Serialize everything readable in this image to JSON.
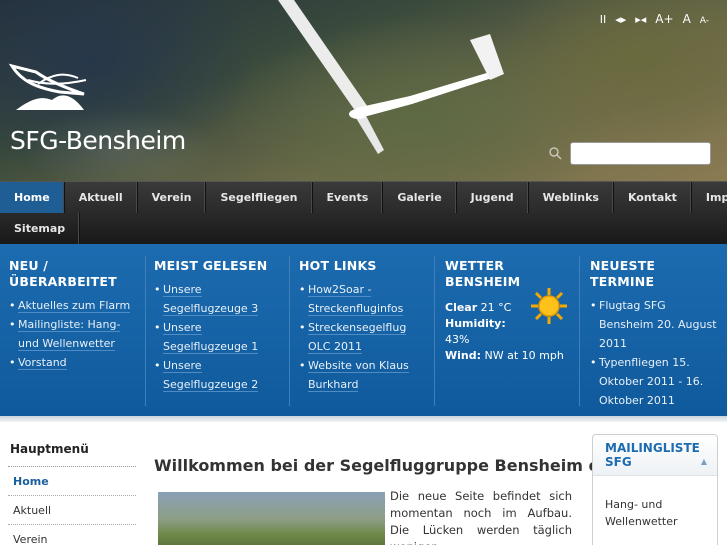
{
  "header": {
    "site_title": "SFG-Bensheim",
    "text_controls": [
      "II",
      "◂▸",
      "▸◂",
      "A+",
      "A",
      "A-"
    ]
  },
  "search": {
    "placeholder": ""
  },
  "nav": {
    "row1": [
      "Home",
      "Aktuell",
      "Verein",
      "Segelfliegen",
      "Events",
      "Galerie",
      "Jugend",
      "Weblinks",
      "Kontakt",
      "Impressum"
    ],
    "row2": [
      "Sitemap"
    ],
    "active": "Home"
  },
  "modules": {
    "new": {
      "title": "Neu / Überarbeitet",
      "items": [
        "Aktuelles zum Flarm",
        "Mailingliste: Hang- und Wellenwetter",
        "Vorstand"
      ]
    },
    "popular": {
      "title": "Meist gelesen",
      "items": [
        "Unsere Segelflugzeuge 3",
        "Unsere Segelflugzeuge 1",
        "Unsere Segelflugzeuge 2"
      ]
    },
    "hotlinks": {
      "title": "Hot Links",
      "items": [
        "How2Soar - Streckenfluginfos",
        "Streckensegelflug OLC 2011",
        "Website von Klaus Burkhard"
      ]
    },
    "weather": {
      "title": "Wetter Bensheim",
      "condition_label": "Clear",
      "temp": "21 °C",
      "humidity_label": "Humidity:",
      "humidity": "43%",
      "wind_label": "Wind:",
      "wind": "NW at 10 mph"
    },
    "events": {
      "title": "Neueste Termine",
      "items": [
        "Flugtag SFG Bensheim 20. August 2011",
        "Typenfliegen 15. Oktober 2011 - 16. Oktober 2011"
      ]
    }
  },
  "menu": {
    "title": "Hauptmenü",
    "items": [
      "Home",
      "Aktuell",
      "Verein"
    ]
  },
  "article": {
    "title": "Willkommen bei der Segelfluggruppe Bensheim e.V.",
    "text": "Die neue Seite befindet sich momentan noch im Aufbau. Die Lücken werden täglich weniger,"
  },
  "sidebar_box": {
    "title": "Mailingliste SFG",
    "items": [
      "Hang- und Wellenwetter"
    ]
  },
  "colors": {
    "nav_active": "#1f5d95",
    "module_bg": "#1d6bb0",
    "link_blue": "#1a5fa0"
  }
}
